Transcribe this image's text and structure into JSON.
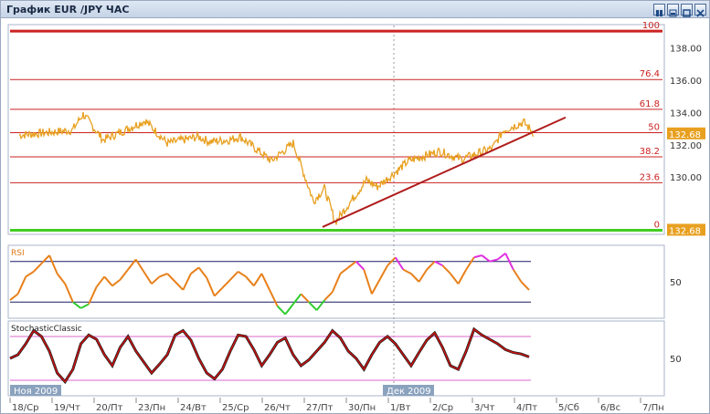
{
  "window": {
    "title": "График EUR /JPY  ЧАС",
    "buttons": [
      "restore-icon",
      "minimize-icon",
      "maximize-icon",
      "close-icon"
    ]
  },
  "colors": {
    "price": "#e8a020",
    "fib": "#cc2222",
    "trend": "#b01c1c",
    "zero_line": "#44cc22",
    "rsi_line": "#e8801a",
    "rsi_over": "#e030e0",
    "rsi_under": "#30cc30",
    "stoch": "#cc1010",
    "price_badge": "#e8a020"
  },
  "price_badges": [
    "132.68",
    "132.68"
  ],
  "fibonacci": {
    "levels": [
      {
        "label": "100",
        "price": 139.05
      },
      {
        "label": "76.4",
        "price": 136.05
      },
      {
        "label": "61.8",
        "price": 134.2
      },
      {
        "label": "50",
        "price": 132.75
      },
      {
        "label": "38.2",
        "price": 131.25
      },
      {
        "label": "23.6",
        "price": 129.65
      },
      {
        "label": "0",
        "price": 126.7
      }
    ]
  },
  "chart_data": [
    {
      "type": "line",
      "title": "График EUR /JPY  ЧАС",
      "y_ticks": [
        "138.00",
        "136.00",
        "134.00",
        "132.00",
        "130.00"
      ],
      "ylim": [
        126.5,
        139.4
      ],
      "grid": false,
      "x_ticks": [
        "18/Ср",
        "19/Чт",
        "20/Пт",
        "23/Пн",
        "24/Вт",
        "25/Ср",
        "26/Чт",
        "27/Пт",
        "30/Пн",
        "1/Вт",
        "2/Ср",
        "3/Чт",
        "4/Пт",
        "5/Сб",
        "6/Вс",
        "7/Пн"
      ],
      "x_month_labels": [
        "Ноя 2009",
        "Дек 2009"
      ],
      "series": [
        {
          "x": [
            "18/Ср",
            "19/Чт",
            "19/Чт",
            "20/Пт",
            "20/Пт",
            "23/Пн",
            "23/Пн",
            "24/Вт",
            "24/Вт",
            "25/Ср",
            "25/Ср",
            "26/Чт",
            "26/Чт",
            "27/Пт",
            "27/Пт",
            "27/Пт",
            "30/Пн",
            "30/Пн",
            "1/Вт",
            "1/Вт",
            "2/Ср",
            "2/Ср",
            "3/Чт",
            "3/Чт",
            "4/Пт",
            "4/Пт"
          ],
          "values": [
            132.6,
            132.9,
            133.9,
            132.3,
            132.6,
            132.1,
            133.5,
            132.5,
            132.2,
            132.3,
            132.5,
            132.1,
            131.0,
            129.3,
            127.2,
            128.5,
            129.8,
            129.4,
            130.4,
            131.0,
            131.1,
            131.6,
            131.8,
            132.9,
            133.4,
            132.68
          ]
        }
      ],
      "annotations": {
        "trendline": {
          "start": {
            "x": "27/Пт",
            "price": 126.9
          },
          "end": {
            "x": "4/Пт",
            "price": 133.7
          }
        }
      }
    },
    {
      "type": "line",
      "title": "RSI",
      "y_ticks": [
        "50"
      ],
      "ylim": [
        15,
        85
      ],
      "levels": [
        70,
        30
      ],
      "series": [
        {
          "values": [
            32,
            38,
            55,
            60,
            68,
            76,
            58,
            48,
            30,
            24,
            28,
            45,
            55,
            46,
            52,
            62,
            72,
            60,
            48,
            55,
            58,
            50,
            42,
            58,
            64,
            54,
            36,
            44,
            52,
            60,
            55,
            46,
            58,
            42,
            26,
            18,
            28,
            38,
            30,
            22,
            32,
            40,
            58,
            64,
            70,
            62,
            38,
            52,
            66,
            74,
            62,
            58,
            50,
            62,
            70,
            66,
            58,
            48,
            62,
            74,
            76,
            70,
            72,
            78,
            62,
            50,
            42
          ]
        }
      ]
    },
    {
      "type": "line",
      "title": "StochasticClassic",
      "y_ticks": [
        "50"
      ],
      "ylim": [
        0,
        100
      ],
      "levels": [
        80,
        20
      ],
      "series": [
        {
          "values": [
            50,
            55,
            70,
            88,
            80,
            60,
            30,
            18,
            35,
            70,
            82,
            76,
            55,
            40,
            65,
            80,
            60,
            45,
            30,
            42,
            55,
            82,
            88,
            75,
            50,
            30,
            22,
            35,
            60,
            82,
            80,
            62,
            40,
            55,
            72,
            78,
            55,
            40,
            48,
            60,
            72,
            88,
            78,
            60,
            50,
            35,
            55,
            72,
            80,
            70,
            55,
            40,
            58,
            75,
            85,
            65,
            40,
            35,
            60,
            90,
            82,
            76,
            70,
            62,
            58,
            56,
            52
          ]
        }
      ]
    }
  ]
}
